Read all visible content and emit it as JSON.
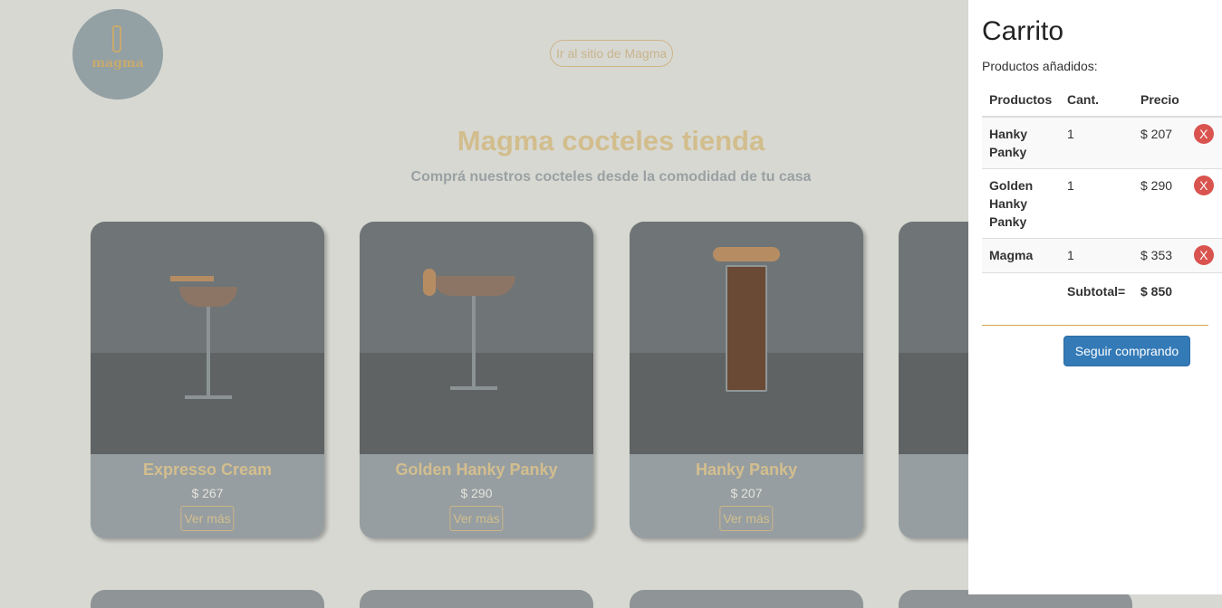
{
  "header": {
    "logo_text": "magma",
    "site_link": "Ir al sitio de Magma"
  },
  "hero": {
    "title": "Magma cocteles tienda",
    "subtitle": "Comprá nuestros cocteles desde la comodidad de tu casa"
  },
  "products": [
    {
      "name": "Expresso Cream",
      "price": "$ 267",
      "more": "Ver más"
    },
    {
      "name": "Golden Hanky Panky",
      "price": "$ 290",
      "more": "Ver más"
    },
    {
      "name": "Hanky Panky",
      "price": "$ 207",
      "more": "Ver más"
    }
  ],
  "cart": {
    "title": "Carrito",
    "added_label": "Productos añadidos:",
    "columns": [
      "Productos",
      "Cant.",
      "Precio"
    ],
    "items": [
      {
        "name": "Hanky Panky",
        "qty": "1",
        "price": "$ 207",
        "remove": "X"
      },
      {
        "name": "Golden Hanky Panky",
        "qty": "1",
        "price": "$ 290",
        "remove": "X"
      },
      {
        "name": "Magma",
        "qty": "1",
        "price": "$ 353",
        "remove": "X"
      }
    ],
    "subtotal_label": "Subtotal=",
    "subtotal_value": "$ 850",
    "continue_label": "Seguir comprando"
  },
  "colors": {
    "accent": "#d2bd8d",
    "button_primary": "#337ab7",
    "remove_button": "#d9534f",
    "overlay_bg": "#d7d8d2"
  }
}
